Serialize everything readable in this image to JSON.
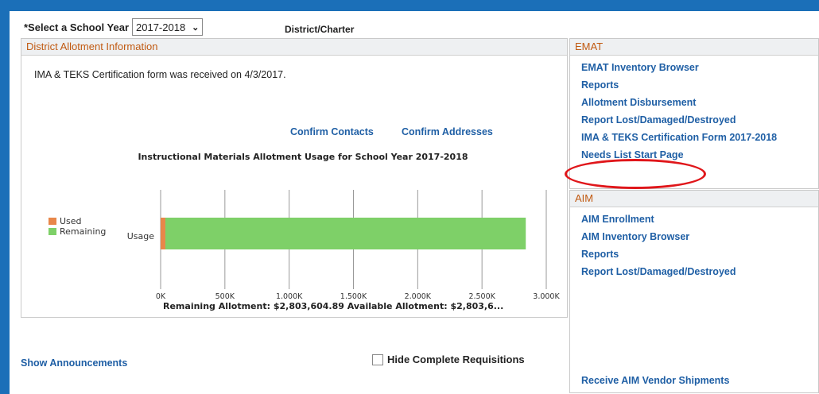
{
  "school_year": {
    "label": "*Select a School Year",
    "selected": "2017-2018"
  },
  "district_charter_label": "District/Charter",
  "district_panel": {
    "title": "District Allotment Information",
    "message": "IMA & TEKS Certification form was received on 4/3/2017.",
    "confirm_contacts": "Confirm Contacts",
    "confirm_addresses": "Confirm Addresses",
    "remaining_text": "Remaining Allotment: $2,803,604.89   Available Allotment: $2,803,6..."
  },
  "chart_data": {
    "type": "bar",
    "orientation": "horizontal",
    "stacked": true,
    "title": "Instructional Materials Allotment Usage for School Year 2017-2018",
    "categories": [
      "Usage"
    ],
    "series": [
      {
        "name": "Used",
        "values": [
          37000
        ],
        "color": "#e8874a"
      },
      {
        "name": "Remaining",
        "values": [
          2803604.89
        ],
        "color": "#7ed068"
      }
    ],
    "xlim": [
      0,
      3000000
    ],
    "x_ticks": [
      "0K",
      "500K",
      "1,000K",
      "1,500K",
      "2,000K",
      "2,500K",
      "3,000K"
    ],
    "legend": "left",
    "grid": true
  },
  "emat_panel": {
    "title": "EMAT",
    "links": [
      "EMAT Inventory Browser",
      "Reports",
      "Allotment Disbursement",
      "Report Lost/Damaged/Destroyed",
      "IMA & TEKS Certification Form 2017-2018",
      "Needs List Start Page"
    ]
  },
  "aim_panel": {
    "title": "AIM",
    "links": [
      "AIM Enrollment",
      "AIM Inventory Browser",
      "Reports",
      "Report Lost/Damaged/Destroyed"
    ],
    "receive": "Receive AIM Vendor Shipments"
  },
  "show_announcements": "Show Announcements",
  "hide_complete": "Hide Complete Requisitions"
}
